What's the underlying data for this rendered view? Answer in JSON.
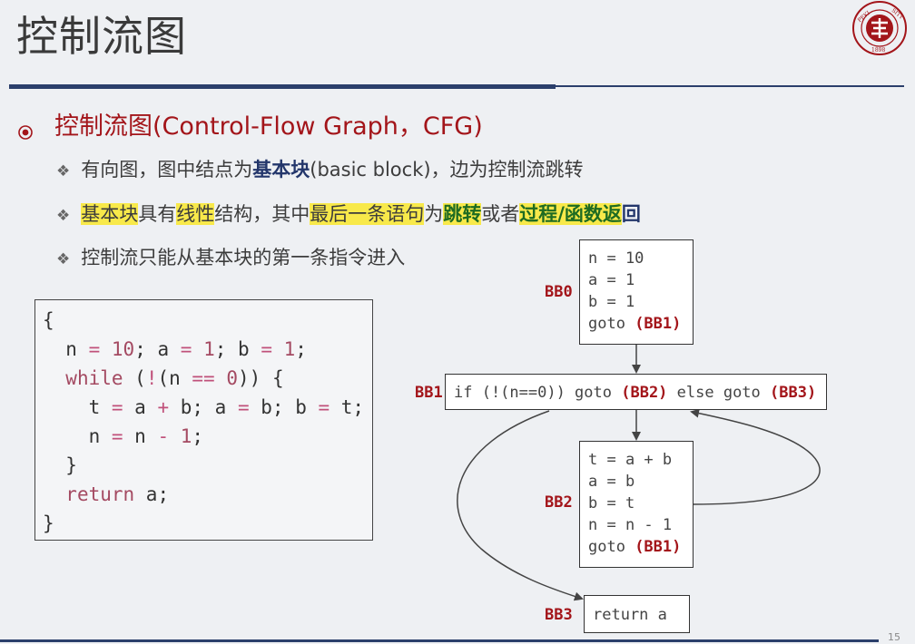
{
  "title": "控制流图",
  "heading": "控制流图(Control-Flow Graph，CFG)",
  "bullets": {
    "b1": {
      "t1": "有向图，图中结点为",
      "t2": "基本块",
      "t3": "(basic block)，边为控制流跳转"
    },
    "b2": {
      "t1": "基本块",
      "t2": "具有",
      "t3": "线性",
      "t4": "结构，其中",
      "t5": "最后一条语句",
      "t6": "为",
      "t7": "跳转",
      "t8": "或者",
      "t9": "过程/函数返",
      "t10": "回"
    },
    "b3": "控制流只能从基本块的第一条指令进入"
  },
  "code": {
    "l1": "{",
    "l2a": "  n ",
    "l2b": "=",
    "l2c": " ",
    "l2d": "10",
    "l2e": "; a ",
    "l2f": "=",
    "l2g": " ",
    "l2h": "1",
    "l2i": "; b ",
    "l2j": "=",
    "l2k": " ",
    "l2l": "1",
    "l2m": ";",
    "l3a": "  ",
    "l3b": "while",
    "l3c": " (",
    "l3d": "!",
    "l3e": "(n ",
    "l3f": "==",
    "l3g": " ",
    "l3h": "0",
    "l3i": ")) {",
    "l4a": "    t ",
    "l4b": "=",
    "l4c": " a ",
    "l4d": "+",
    "l4e": " b; a ",
    "l4f": "=",
    "l4g": " b; b ",
    "l4h": "=",
    "l4i": " t;",
    "l5a": "    n ",
    "l5b": "=",
    "l5c": " n ",
    "l5d": "-",
    "l5e": " ",
    "l5f": "1",
    "l5g": ";",
    "l6": "  }",
    "l7a": "  ",
    "l7b": "return",
    "l7c": " a;",
    "l8": "}"
  },
  "cfg": {
    "bb0": {
      "label": "BB0",
      "lines": [
        "n = 10",
        "a = 1",
        "b = 1"
      ],
      "goto": "goto ",
      "target": "(BB1)"
    },
    "bb1": {
      "label": "BB1",
      "pre": "if (!(n==0)) goto ",
      "t1": "(BB2)",
      "mid": " else goto ",
      "t2": "(BB3)"
    },
    "bb2": {
      "label": "BB2",
      "lines": [
        "t = a + b",
        "a = b",
        "b = t",
        "n = n - 1"
      ],
      "goto": "goto ",
      "target": "(BB1)"
    },
    "bb3": {
      "label": "BB3",
      "text": "return a"
    }
  },
  "page_number": "15",
  "colors": {
    "accent_red": "#a3151a",
    "navy": "#23366b",
    "highlight": "#f8e94a",
    "green": "#1e6b22"
  }
}
